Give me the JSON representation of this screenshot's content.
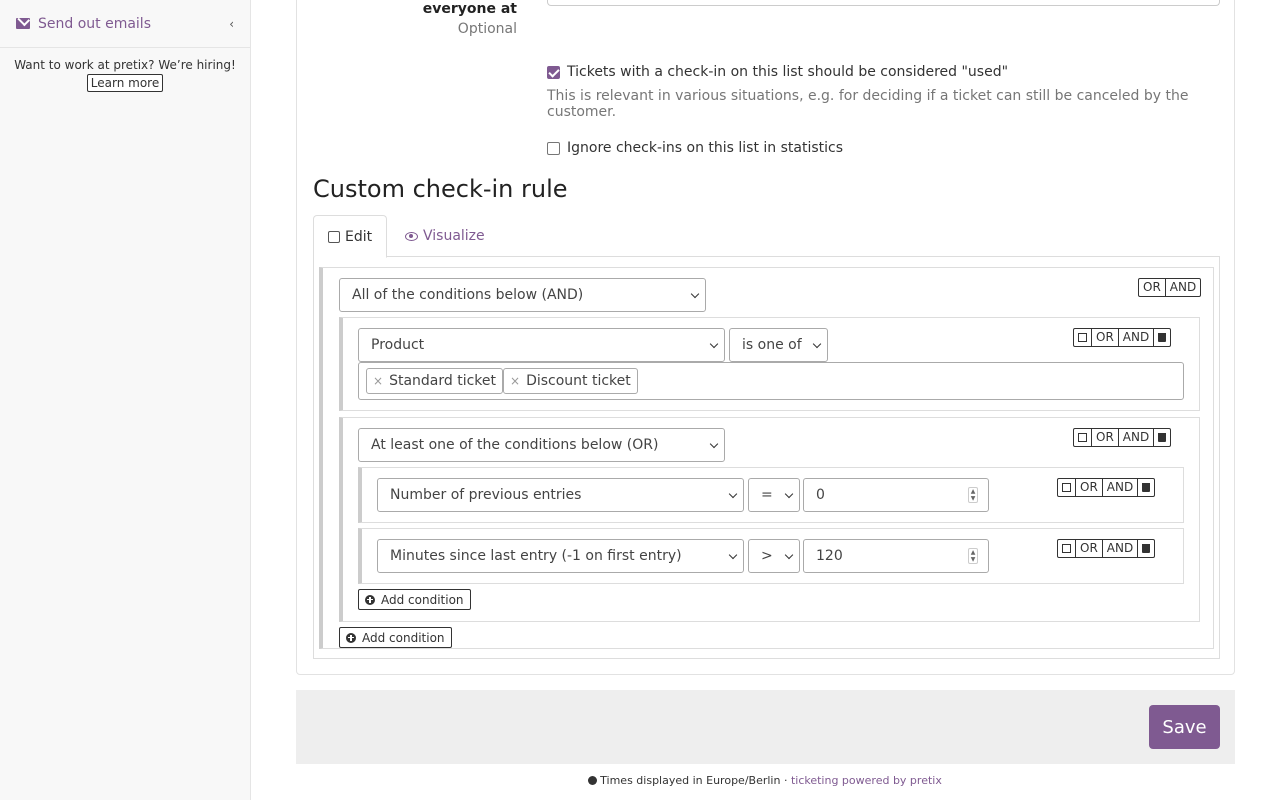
{
  "sidebar": {
    "send_emails": "Send out emails",
    "hiring_text": "Want to work at pretix? We’re hiring!",
    "learn_more": "Learn more"
  },
  "form": {
    "field_label": "everyone at",
    "field_optional": "Optional",
    "consider_used": {
      "label": "Tickets with a check-in on this list should be considered \"used\"",
      "checked": true,
      "help": "This is relevant in various situations, e.g. for deciding if a ticket can still be canceled by the customer."
    },
    "ignore_stats": {
      "label": "Ignore check-ins on this list in statistics",
      "checked": false
    }
  },
  "rules": {
    "title": "Custom check-in rule",
    "tabs": {
      "edit": "Edit",
      "visualize": "Visualize"
    },
    "root_select": "All of the conditions below (AND)",
    "product_select": "Product",
    "product_operator": "is one of",
    "product_tags": [
      "Standard ticket",
      "Discount ticket"
    ],
    "or_group_select": "At least one of the conditions below (OR)",
    "cond1": {
      "field": "Number of previous entries",
      "op": "=",
      "value": "0"
    },
    "cond2": {
      "field": "Minutes since last entry (-1 on first entry)",
      "op": ">",
      "value": "120"
    },
    "add_condition": "Add condition",
    "btn_or": "OR",
    "btn_and": "AND"
  },
  "actions": {
    "save": "Save"
  },
  "footer": {
    "timezone": "Times displayed in Europe/Berlin",
    "sep": " · ",
    "powered": "ticketing powered by pretix"
  },
  "colors": {
    "brand": "#7f5a91"
  }
}
